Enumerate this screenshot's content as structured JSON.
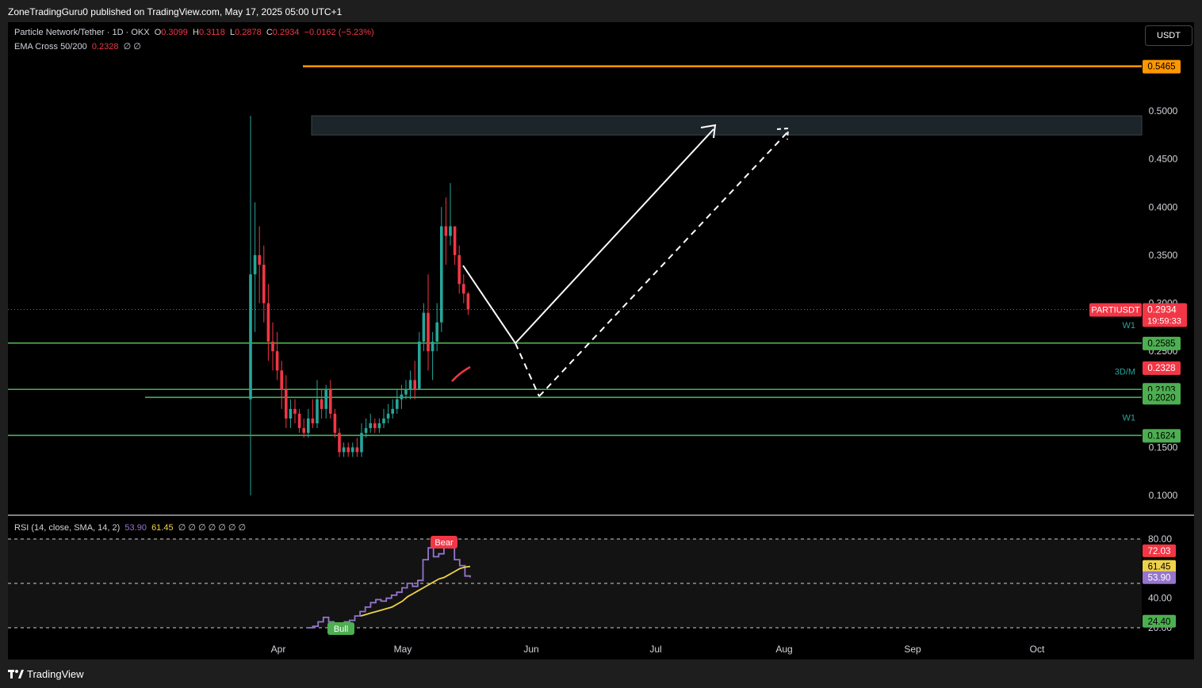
{
  "publisher": "ZoneTradingGuru0 published on TradingView.com, May 17, 2025 05:00 UTC+1",
  "brand": "TradingView",
  "currency_button": "USDT",
  "legend": {
    "symbol": "Particle Network/Tether · 1D · OKX",
    "o_label": "O",
    "o_value": "0.3099",
    "h_label": "H",
    "h_value": "0.3118",
    "l_label": "L",
    "l_value": "0.2878",
    "c_label": "C",
    "c_value": "0.2934",
    "change": "−0.0162 (−5.23%)",
    "ema_label": "EMA Cross 50/200",
    "ema_value": "0.2328",
    "ema_extra": "∅ ∅"
  },
  "rsi_legend": {
    "label": "RSI (14, close, SMA, 14, 2)",
    "rsi_value": "53.90",
    "sma_value": "61.45",
    "extra": "∅ ∅ ∅ ∅ ∅ ∅ ∅"
  },
  "colors": {
    "up": "#26a69a",
    "down": "#f23645",
    "level": "#4caf50",
    "orange": "#ff9800",
    "rsi": "#9575cd",
    "rsi_sma": "#f0d24a"
  },
  "chart_data": [
    {
      "type": "candlestick",
      "title": "Particle Network/Tether · 1D · OKX",
      "x_ticks": [
        "Apr",
        "May",
        "Jun",
        "Jul",
        "Aug",
        "Sep",
        "Oct"
      ],
      "y_ticks": [
        "0.1000",
        "0.1500",
        "0.2000",
        "0.2500",
        "0.3000",
        "0.3500",
        "0.4000",
        "0.4500",
        "0.5000",
        "0.5465"
      ],
      "ylim": [
        0.08,
        0.56
      ],
      "last_price": {
        "label": "PARTIUSDT",
        "value": "0.2934",
        "countdown": "19:59:33"
      },
      "levels": [
        {
          "value": 0.5465,
          "label": "0.5465",
          "color": "#ff9800"
        },
        {
          "value": 0.2585,
          "label": "0.2585",
          "tag": "W1",
          "color": "#4caf50"
        },
        {
          "value": 0.2103,
          "label": "0.2103",
          "tag": "3D/M",
          "color": "#4caf50"
        },
        {
          "value": 0.202,
          "label": "0.2020",
          "color": "#4caf50"
        },
        {
          "value": 0.1624,
          "label": "0.1624",
          "tag": "W1",
          "color": "#4caf50"
        }
      ],
      "ema_marker": {
        "value": 0.2328,
        "label": "0.2328"
      },
      "target_zone": [
        0.475,
        0.495
      ],
      "candles": [
        [
          0.2,
          0.495,
          0.1,
          0.33
        ],
        [
          0.33,
          0.405,
          0.27,
          0.35
        ],
        [
          0.35,
          0.38,
          0.3,
          0.34
        ],
        [
          0.34,
          0.36,
          0.28,
          0.3
        ],
        [
          0.3,
          0.32,
          0.24,
          0.26
        ],
        [
          0.26,
          0.28,
          0.23,
          0.25
        ],
        [
          0.25,
          0.27,
          0.22,
          0.23
        ],
        [
          0.23,
          0.24,
          0.19,
          0.21
        ],
        [
          0.21,
          0.225,
          0.17,
          0.18
        ],
        [
          0.18,
          0.2,
          0.17,
          0.19
        ],
        [
          0.19,
          0.2,
          0.175,
          0.185
        ],
        [
          0.185,
          0.19,
          0.165,
          0.17
        ],
        [
          0.17,
          0.18,
          0.16,
          0.165
        ],
        [
          0.165,
          0.19,
          0.16,
          0.18
        ],
        [
          0.18,
          0.2,
          0.17,
          0.175
        ],
        [
          0.175,
          0.22,
          0.17,
          0.2
        ],
        [
          0.2,
          0.21,
          0.18,
          0.19
        ],
        [
          0.19,
          0.215,
          0.18,
          0.21
        ],
        [
          0.21,
          0.22,
          0.18,
          0.185
        ],
        [
          0.185,
          0.19,
          0.16,
          0.165
        ],
        [
          0.165,
          0.17,
          0.14,
          0.145
        ],
        [
          0.145,
          0.155,
          0.14,
          0.15
        ],
        [
          0.15,
          0.155,
          0.14,
          0.145
        ],
        [
          0.145,
          0.155,
          0.14,
          0.15
        ],
        [
          0.15,
          0.16,
          0.14,
          0.145
        ],
        [
          0.145,
          0.175,
          0.14,
          0.165
        ],
        [
          0.165,
          0.18,
          0.16,
          0.17
        ],
        [
          0.17,
          0.185,
          0.165,
          0.175
        ],
        [
          0.175,
          0.18,
          0.165,
          0.17
        ],
        [
          0.17,
          0.18,
          0.165,
          0.175
        ],
        [
          0.175,
          0.19,
          0.17,
          0.18
        ],
        [
          0.18,
          0.195,
          0.175,
          0.185
        ],
        [
          0.185,
          0.2,
          0.18,
          0.19
        ],
        [
          0.19,
          0.21,
          0.185,
          0.2
        ],
        [
          0.2,
          0.215,
          0.19,
          0.205
        ],
        [
          0.205,
          0.22,
          0.2,
          0.21
        ],
        [
          0.21,
          0.23,
          0.2,
          0.22
        ],
        [
          0.22,
          0.24,
          0.2,
          0.21
        ],
        [
          0.21,
          0.27,
          0.21,
          0.26
        ],
        [
          0.26,
          0.3,
          0.25,
          0.29
        ],
        [
          0.29,
          0.33,
          0.23,
          0.25
        ],
        [
          0.25,
          0.27,
          0.22,
          0.26
        ],
        [
          0.26,
          0.3,
          0.25,
          0.28
        ],
        [
          0.28,
          0.4,
          0.27,
          0.38
        ],
        [
          0.38,
          0.41,
          0.34,
          0.37
        ],
        [
          0.37,
          0.425,
          0.36,
          0.38
        ],
        [
          0.38,
          0.38,
          0.34,
          0.35
        ],
        [
          0.35,
          0.36,
          0.31,
          0.32
        ],
        [
          0.32,
          0.33,
          0.3,
          0.31
        ],
        [
          0.31,
          0.3118,
          0.2878,
          0.2934
        ]
      ]
    },
    {
      "type": "line",
      "title": "RSI (14, close, SMA, 14, 2)",
      "y_ticks": [
        "20.00",
        "40.00",
        "60.00",
        "80.00"
      ],
      "ylim": [
        18,
        84
      ],
      "bands": [
        20,
        40,
        80
      ],
      "labels": [
        {
          "value": 72.03,
          "label": "72.03"
        },
        {
          "value": 61.45,
          "label": "61.45"
        },
        {
          "value": 53.9,
          "label": "53.90"
        },
        {
          "value": 24.4,
          "label": "24.40"
        }
      ],
      "signals": [
        {
          "label": "Bull"
        },
        {
          "label": "Bear"
        }
      ],
      "series": [
        {
          "name": "RSI",
          "values": [
            20,
            21,
            24,
            27,
            24,
            23,
            22,
            24,
            25,
            28,
            31,
            34,
            37,
            39,
            38,
            40,
            42,
            44,
            47,
            50,
            48,
            52,
            66,
            74,
            68,
            70,
            76,
            74,
            66,
            62,
            55,
            54
          ]
        },
        {
          "name": "SMA",
          "values": [
            28,
            29,
            30,
            31,
            32,
            33,
            34,
            36,
            38,
            41,
            43,
            45,
            47,
            49,
            51,
            53,
            54,
            56,
            58,
            60,
            61,
            61.45
          ]
        }
      ]
    }
  ]
}
